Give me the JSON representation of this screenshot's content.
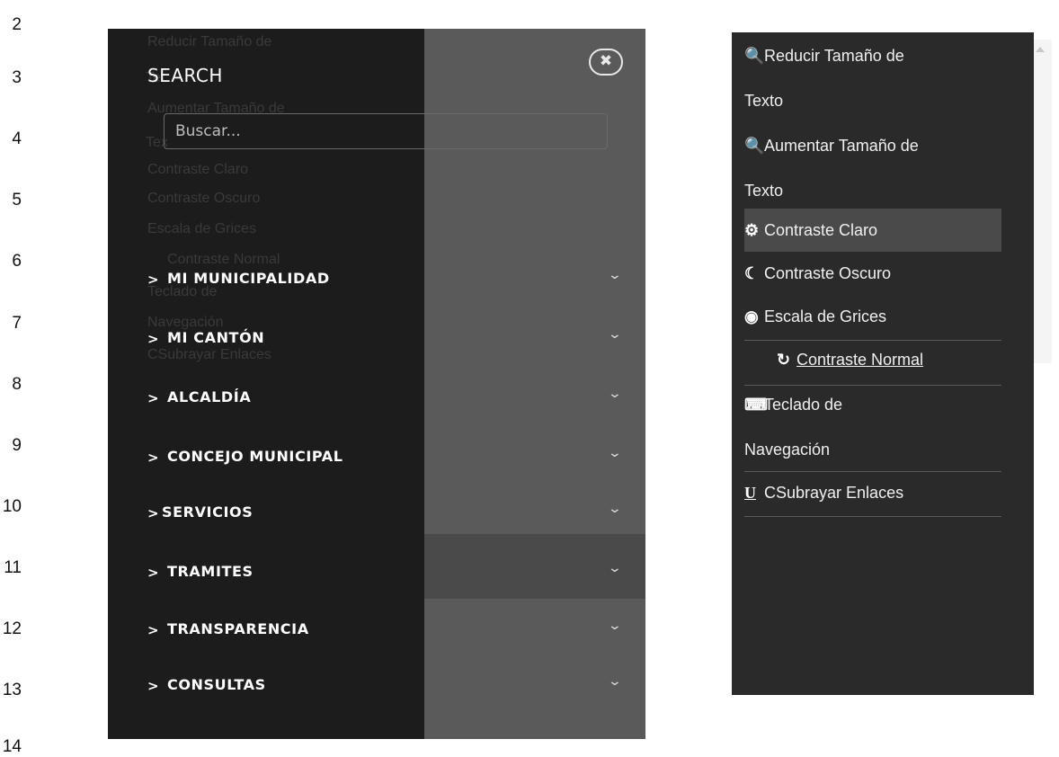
{
  "line_numbers": [
    "2",
    "3",
    "4",
    "5",
    "6",
    "7",
    "8",
    "9",
    "10",
    "11",
    "12",
    "13",
    "14"
  ],
  "left_menu": {
    "search_title": "SEARCH",
    "search_placeholder": "Buscar...",
    "close_icon": "close-icon",
    "ghost_items": [
      "Reducir Tamaño de",
      "Te",
      "Aumentar Tamaño de",
      "Tex",
      "Contraste Claro",
      "Contraste Oscuro",
      "Escala de Grices",
      "Contraste Normal",
      "Teclado de",
      "Navegación",
      "CSubrayar Enlaces"
    ],
    "nav_items": [
      {
        "arrow": ">",
        "label": "MI MUNICIPALIDAD",
        "chevron": "⌄"
      },
      {
        "arrow": ">",
        "label": "MI CANTÓN",
        "chevron": "⌄"
      },
      {
        "arrow": ">",
        "label": "ALCALDÍA",
        "chevron": "⌄"
      },
      {
        "arrow": ">",
        "label": "CONCEJO MUNICIPAL",
        "chevron": "⌄"
      },
      {
        "arrow": ">",
        "label": "SERVICIOS",
        "chevron": "⌄"
      },
      {
        "arrow": ">",
        "label": "TRAMITES",
        "chevron": "⌄"
      },
      {
        "arrow": ">",
        "label": "TRANSPARENCIA",
        "chevron": "⌄"
      },
      {
        "arrow": ">",
        "label": "CONSULTAS",
        "chevron": "⌄"
      }
    ]
  },
  "accessibility_menu": {
    "items": [
      {
        "icon": "zoom-out-icon",
        "glyph": "🔍",
        "label": "Reducir Tamaño de"
      },
      {
        "icon": "",
        "glyph": "",
        "label": "Texto"
      },
      {
        "icon": "zoom-in-icon",
        "glyph": "🔍",
        "label": "Aumentar Tamaño de"
      },
      {
        "icon": "",
        "glyph": "",
        "label": "Texto"
      },
      {
        "icon": "gear-contrast-icon",
        "glyph": "⚙",
        "label": "Contraste Claro"
      },
      {
        "icon": "moon-icon",
        "glyph": "☾",
        "label": "Contraste Oscuro"
      },
      {
        "icon": "grayscale-icon",
        "glyph": "◉",
        "label": "Escala de Grices"
      },
      {
        "icon": "refresh-icon",
        "glyph": "↻",
        "label": "Contraste Normal"
      },
      {
        "icon": "keyboard-icon",
        "glyph": "⌨",
        "label": "Teclado de"
      },
      {
        "icon": "",
        "glyph": "",
        "label": "Navegación"
      },
      {
        "icon": "underline-icon",
        "glyph": "U",
        "label": "CSubrayar Enlaces"
      }
    ]
  }
}
